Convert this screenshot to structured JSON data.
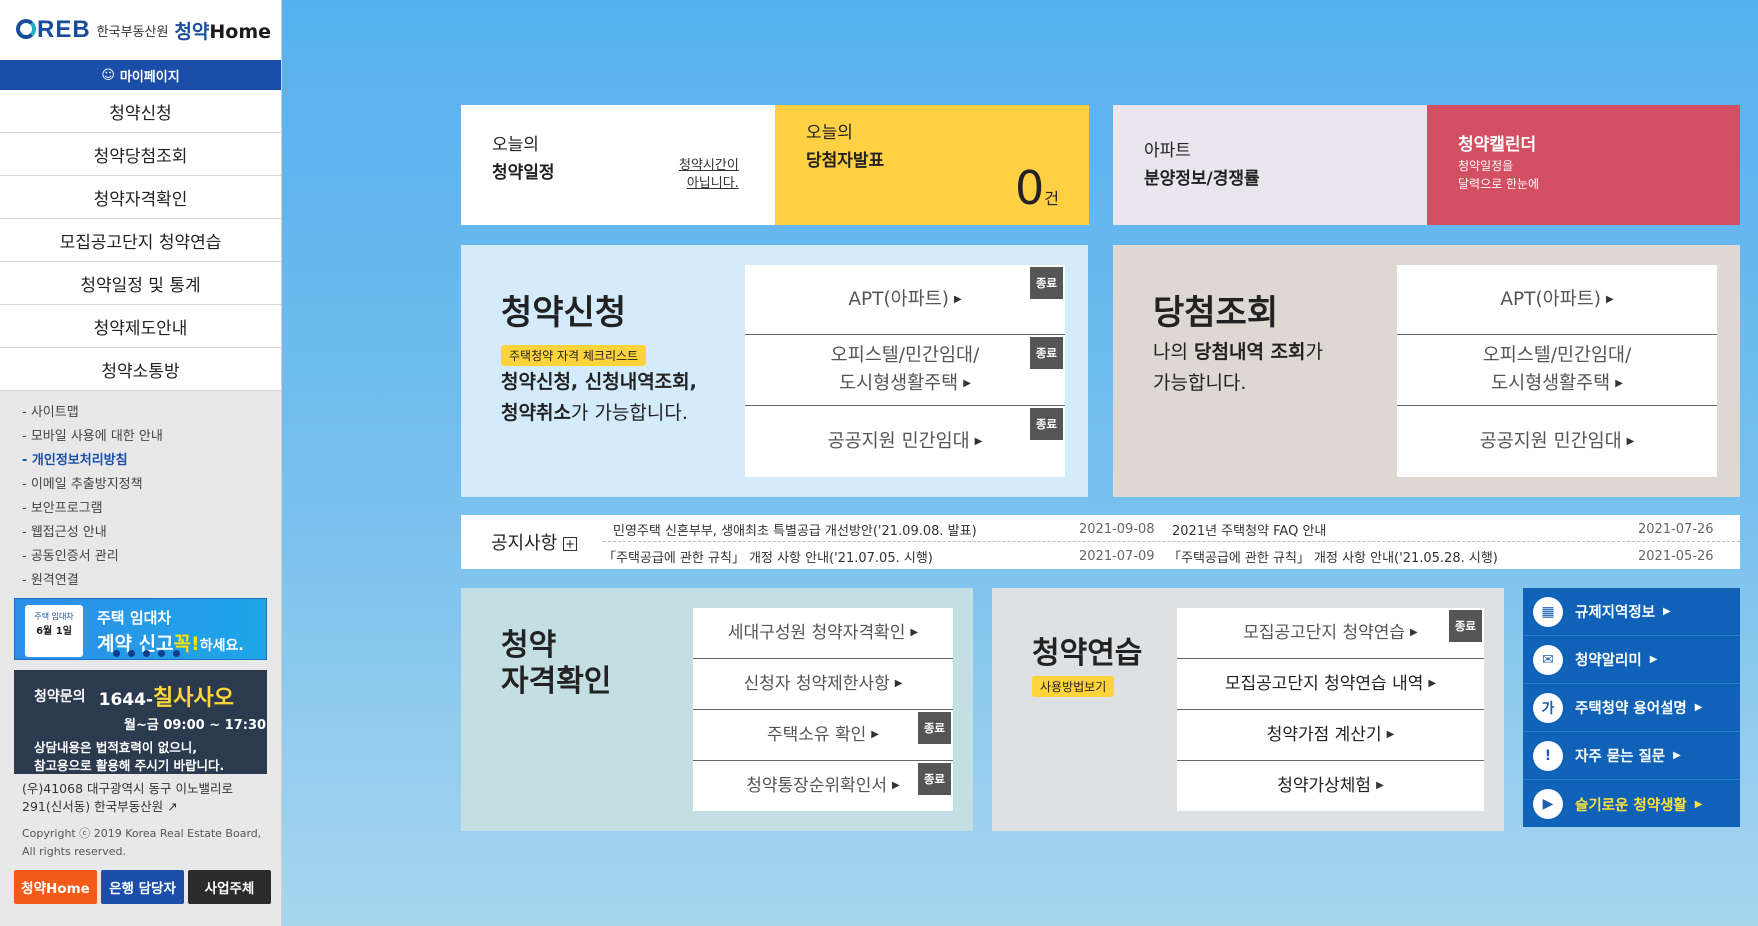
{
  "sidebar": {
    "logo": {
      "reb": "REB",
      "org": "한국부동산원",
      "home_a": "청약",
      "home_b": "Home"
    },
    "mypage": "마이페이지",
    "menu": [
      "청약신청",
      "청약당첨조회",
      "청약자격확인",
      "모집공고단지 청약연습",
      "청약일정 및 통계",
      "청약제도안내",
      "청약소통방"
    ],
    "links": [
      "- 사이트맵",
      "- 모바일 사용에 대한 안내",
      "- 개인정보처리방침",
      "- 이메일 추출방지정책",
      "- 보안프로그램",
      "- 웹접근성 안내",
      "- 공동인증서 관리",
      "- 원격연결"
    ],
    "banner": {
      "cal_top": "주택 임대차",
      "cal_date": "6월 1일",
      "line1": "주택 임대차",
      "line2_a": "계약 ",
      "line2_b": "신고",
      "line2_c": "꼭!",
      "line2_d": "하세요."
    },
    "contact": {
      "label": "청약문의",
      "tel_a": "1644-",
      "tel_b": "칠사사오",
      "hours": "월~금 09:00 ~ 17:30",
      "note1": "상담내용은 법적효력이 없으니,",
      "note2": "참고용으로 활용해 주시기 바랍니다."
    },
    "address": "(우)41068 대구광역시 동구 이노밸리로 291(신서동) 한국부동산원",
    "copyright": "Copyright ⓒ 2019 Korea Real Estate Board, All rights reserved.",
    "buttons": [
      "청약Home",
      "은행 담당자",
      "사업주체"
    ]
  },
  "top": {
    "today_sched": {
      "l1": "오늘의",
      "l2": "청약일정",
      "note_a": "청약시간이",
      "note_b": "아닙니다."
    },
    "winner": {
      "l1": "오늘의",
      "l2": "당첨자발표",
      "count": "0",
      "unit": "건"
    },
    "apt": {
      "l1": "아파트",
      "l2": "분양정보/경쟁률"
    },
    "calendar": {
      "title": "청약캘린더",
      "s1": "청약일정을",
      "s2": "달력으로 한눈에"
    }
  },
  "apply": {
    "title": "청약신청",
    "badge": "주택청약 자격 체크리스트",
    "d1_b": "청약신청, 신청내역조회,",
    "d2_b": "청약취소",
    "d2_s": "가 가능합니다.",
    "links": [
      {
        "l1": "APT(아파트)",
        "l2": "",
        "end": "종료"
      },
      {
        "l1": "오피스텔/민간임대/",
        "l2": "도시형생활주택",
        "end": "종료"
      },
      {
        "l1": "공공지원 민간임대",
        "l2": "",
        "end": "종료"
      }
    ]
  },
  "win": {
    "title": "당첨조회",
    "d1_s": "나의 ",
    "d1_b": "당첨내역 조회",
    "d1_e": "가",
    "d2": "가능합니다.",
    "links": [
      {
        "l1": "APT(아파트)",
        "l2": ""
      },
      {
        "l1": "오피스텔/민간임대/",
        "l2": "도시형생활주택"
      },
      {
        "l1": "공공지원 민간임대",
        "l2": ""
      }
    ]
  },
  "notice": {
    "title": "공지사항",
    "plus": "+",
    "items": [
      {
        "text": "민영주택 신혼부부, 생애최초 특별공급 개선방안('21.09.08. 발표)",
        "date": "2021-09-08"
      },
      {
        "text": "2021년 주택청약 FAQ 안내",
        "date": "2021-07-26"
      },
      {
        "text": "「주택공급에 관한 규칙」 개정 사항 안내('21.07.05. 시행)",
        "date": "2021-07-09"
      },
      {
        "text": "「주택공급에 관한 규칙」 개정 사항 안내('21.05.28. 시행)",
        "date": "2021-05-26"
      }
    ]
  },
  "qualify": {
    "t1": "청약",
    "t2": "자격확인",
    "links": [
      {
        "label": "세대구성원 청약자격확인",
        "end": ""
      },
      {
        "label": "신청자 청약제한사항",
        "end": ""
      },
      {
        "label": "주택소유 확인",
        "end": "종료"
      },
      {
        "label": "청약통장순위확인서",
        "end": "종료"
      }
    ]
  },
  "practice": {
    "title": "청약연습",
    "badge": "사용방법보기",
    "links": [
      {
        "label": "모집공고단지 청약연습",
        "end": "종료"
      },
      {
        "label": "모집공고단지 청약연습 내역",
        "end": ""
      },
      {
        "label": "청약가점 계산기",
        "end": ""
      },
      {
        "label": "청약가상체험",
        "end": ""
      }
    ]
  },
  "quick": [
    {
      "icon": "building-icon",
      "glyph": "▦",
      "label": "규제지역정보"
    },
    {
      "icon": "mail-icon",
      "glyph": "✉",
      "label": "청약알리미"
    },
    {
      "icon": "dictionary-icon",
      "glyph": "가",
      "label": "주택청약 용어설명"
    },
    {
      "icon": "exclamation-icon",
      "glyph": "!",
      "label": "자주 묻는 질문"
    },
    {
      "icon": "video-icon",
      "glyph": "▶",
      "label": "슬기로운 청약생활"
    }
  ],
  "colors": {
    "blue": "#1a4ea8",
    "yellow": "#ffd043",
    "pink": "#d34f62",
    "quick": "#0f62b8"
  }
}
